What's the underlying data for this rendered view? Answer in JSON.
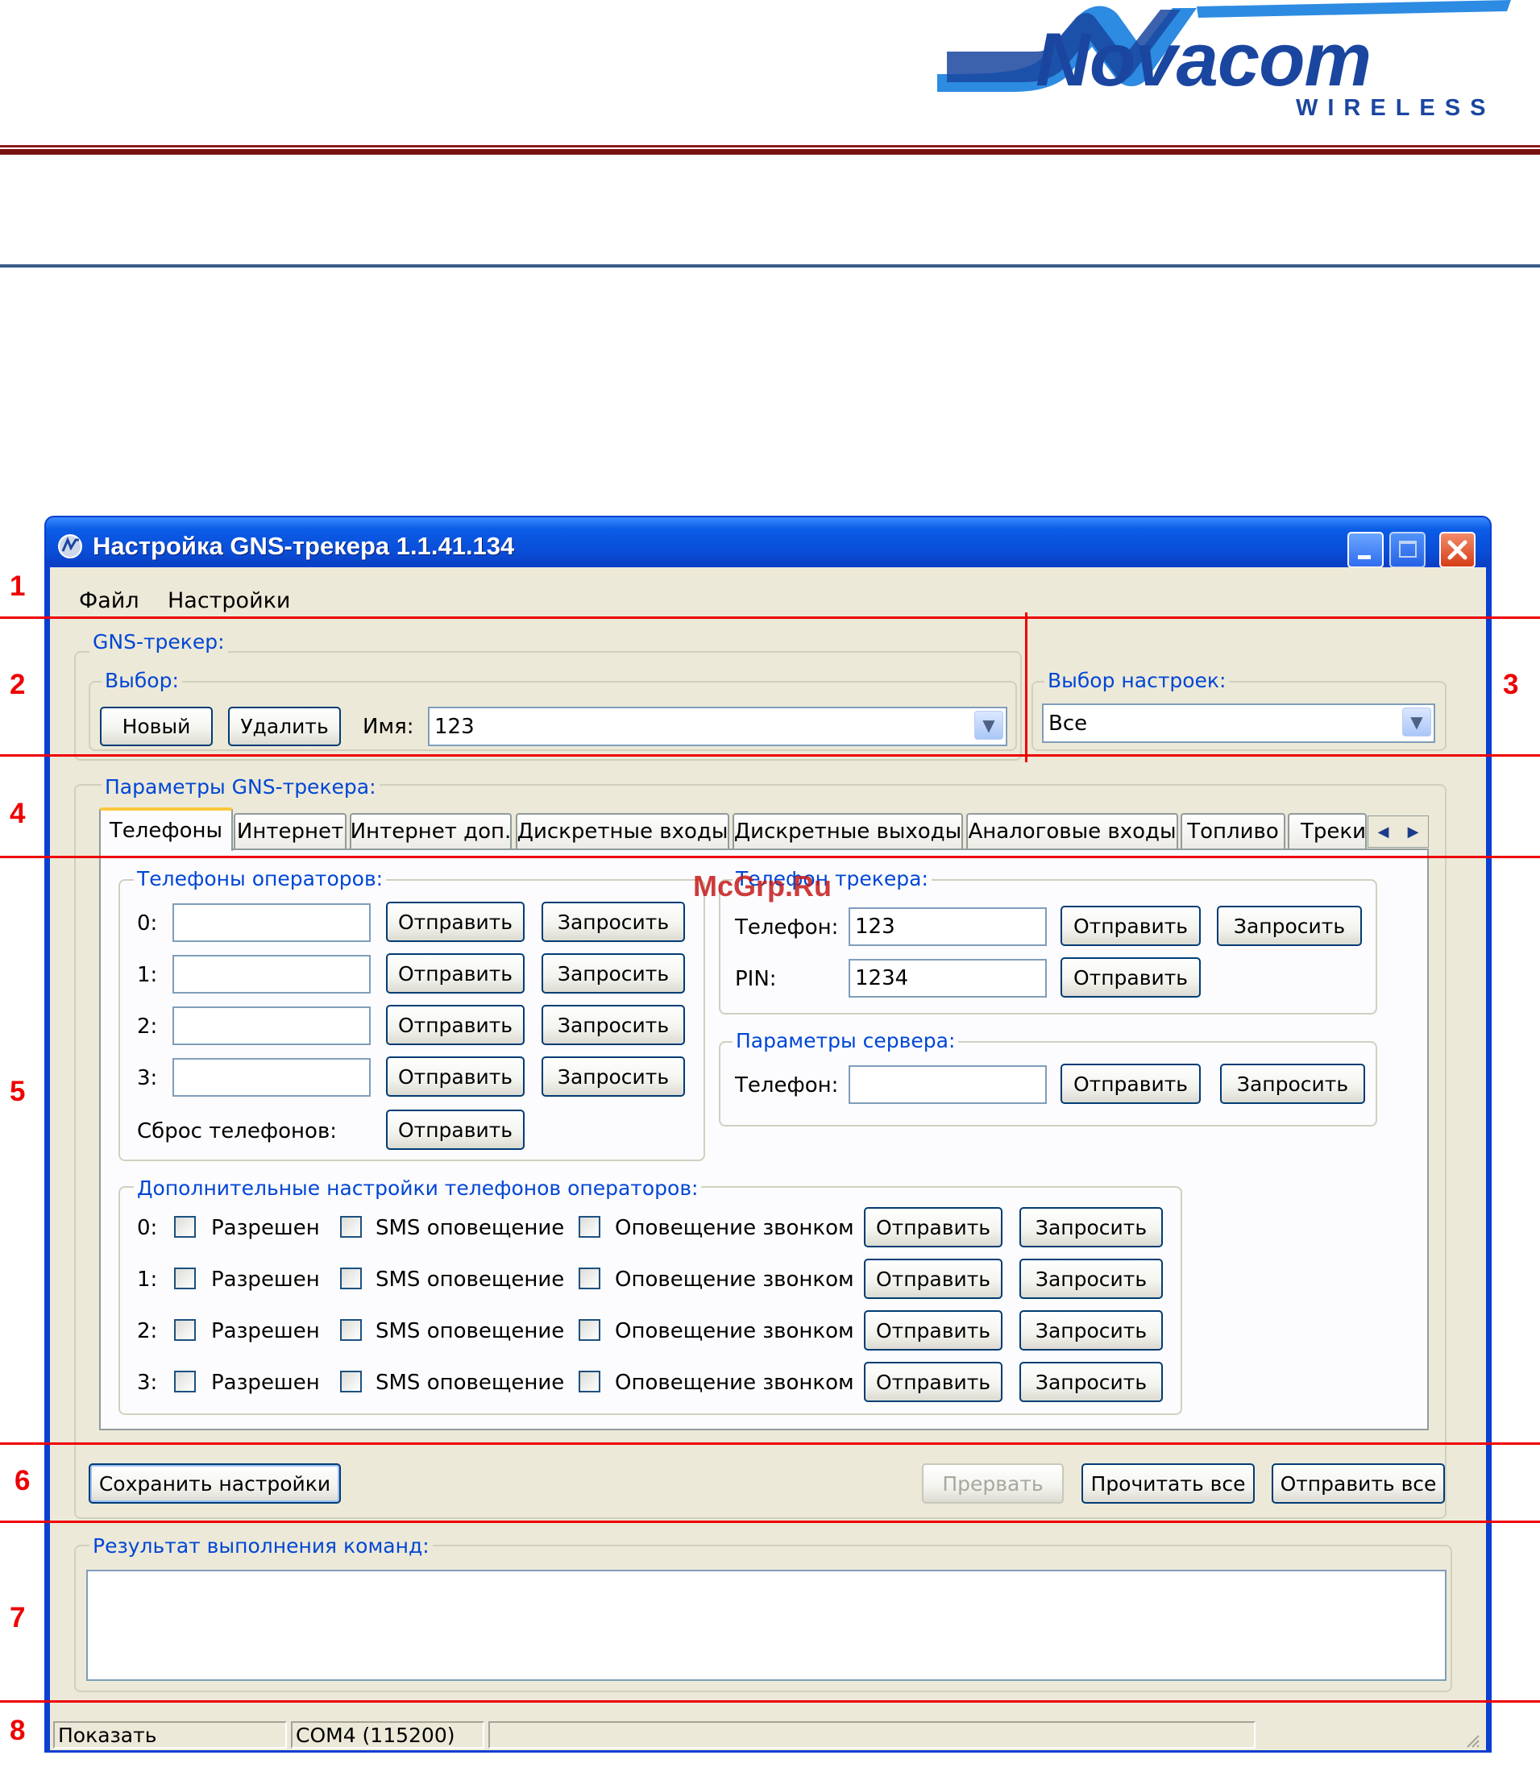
{
  "header": {
    "logo_word": "Novacom",
    "logo_sub": "WIRELESS",
    "logo_colors": {
      "blue": "#1a46a0",
      "accent": "#2d8be2"
    }
  },
  "window": {
    "title": "Настройка GNS-трекера 1.1.41.134"
  },
  "menu": [
    "Файл",
    "Настройки"
  ],
  "tracker_group": {
    "label": "GNS-трекер:",
    "choice_label": "Выбор:",
    "new_button": "Новый",
    "delete_button": "Удалить",
    "name_label": "Имя:",
    "name_value": "123"
  },
  "settings_select": {
    "label": "Выбор настроек:",
    "value": "Все"
  },
  "params": {
    "label": "Параметры GNS-трекера:",
    "tabs": [
      "Телефоны",
      "Интернет",
      "Интернет доп.",
      "Дискретные входы",
      "Дискретные выходы",
      "Аналоговые входы",
      "Топливо",
      "Трекин"
    ],
    "active_tab": "Телефоны"
  },
  "operators": {
    "label": "Телефоны операторов:",
    "rows": [
      {
        "index": "0:",
        "value": "",
        "send": "Отправить",
        "request": "Запросить"
      },
      {
        "index": "1:",
        "value": "",
        "send": "Отправить",
        "request": "Запросить"
      },
      {
        "index": "2:",
        "value": "",
        "send": "Отправить",
        "request": "Запросить"
      },
      {
        "index": "3:",
        "value": "",
        "send": "Отправить",
        "request": "Запросить"
      }
    ],
    "reset_label": "Сброс телефонов:",
    "reset_button": "Отправить"
  },
  "tracker_phone": {
    "label": "Телефон трекера:",
    "phone_label": "Телефон:",
    "phone_value": "123",
    "send": "Отправить",
    "request": "Запросить",
    "pin_label": "PIN:",
    "pin_value": "1234",
    "pin_send": "Отправить"
  },
  "server": {
    "label": "Параметры сервера:",
    "phone_label": "Телефон:",
    "phone_value": "",
    "send": "Отправить",
    "request": "Запросить"
  },
  "extra": {
    "label": "Дополнительные настройки телефонов операторов:",
    "rows": [
      {
        "index": "0:",
        "allowed": "Разрешен",
        "sms": "SMS оповещение",
        "call": "Оповещение звонком",
        "send": "Отправить",
        "request": "Запросить"
      },
      {
        "index": "1:",
        "allowed": "Разрешен",
        "sms": "SMS оповещение",
        "call": "Оповещение звонком",
        "send": "Отправить",
        "request": "Запросить"
      },
      {
        "index": "2:",
        "allowed": "Разрешен",
        "sms": "SMS оповещение",
        "call": "Оповещение звонком",
        "send": "Отправить",
        "request": "Запросить"
      },
      {
        "index": "3:",
        "allowed": "Разрешен",
        "sms": "SMS оповещение",
        "call": "Оповещение звонком",
        "send": "Отправить",
        "request": "Запросить"
      }
    ]
  },
  "actions": {
    "save": "Сохранить настройки",
    "abort": "Прервать",
    "read_all": "Прочитать все",
    "send_all": "Отправить все"
  },
  "results": {
    "label": "Результат выполнения команд:",
    "text": ""
  },
  "status": {
    "show": "Показать",
    "port": "COM4 (115200)",
    "extra": ""
  },
  "annotations": [
    "1",
    "2",
    "3",
    "4",
    "5",
    "6",
    "7",
    "8"
  ],
  "watermark": "McGrp.Ru",
  "colors": {
    "annotation": "#ee0000",
    "titlebar": "#0a4ed8",
    "group_label": "#0046d5"
  }
}
